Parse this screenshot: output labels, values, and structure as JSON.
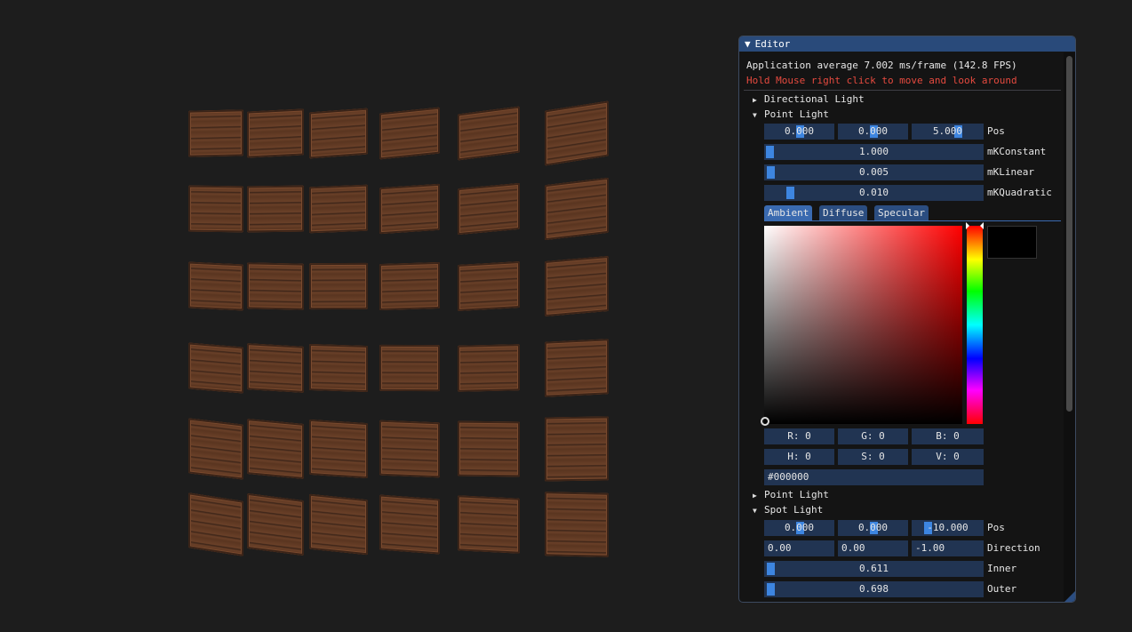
{
  "scene": {
    "crate_colors": [
      "#5a3520",
      "#6a4028",
      "#3b2418",
      "#7a4a2e"
    ]
  },
  "editor": {
    "title": "Editor",
    "fps_text": "Application average 7.002 ms/frame (142.8 FPS)",
    "hint_text": "Hold Mouse right click to move and look around",
    "directional_light": {
      "label": "Directional Light"
    },
    "point_light": {
      "label": "Point Light",
      "pos": [
        "0.000",
        "0.000",
        "5.000"
      ],
      "pos_label": "Pos",
      "constant": {
        "value": "1.000",
        "label": "mKConstant"
      },
      "linear": {
        "value": "0.005",
        "label": "mKLinear"
      },
      "quadratic": {
        "value": "0.010",
        "label": "mKQuadratic"
      },
      "tabs": [
        "Ambient",
        "Diffuse",
        "Specular"
      ],
      "active_tab": "Ambient",
      "rgb": {
        "r": "R:  0",
        "g": "G:  0",
        "b": "B:  0"
      },
      "hsv": {
        "h": "H:  0",
        "s": "S:  0",
        "v": "V:  0"
      },
      "hex": "#000000",
      "color": "#000000"
    },
    "point_light_2": {
      "label": "Point Light"
    },
    "spot_light": {
      "label": "Spot Light",
      "pos": [
        "0.000",
        "0.000",
        "-10.000"
      ],
      "pos_label": "Pos",
      "direction": [
        "0.00",
        "0.00",
        "-1.00"
      ],
      "direction_label": "Direction",
      "inner": {
        "value": "0.611",
        "label": "Inner"
      },
      "outer": {
        "value": "0.698",
        "label": "Outer"
      }
    },
    "accent_color": "#3d85e0",
    "frame_bg": "#213452",
    "title_bg": "#294a7a"
  }
}
